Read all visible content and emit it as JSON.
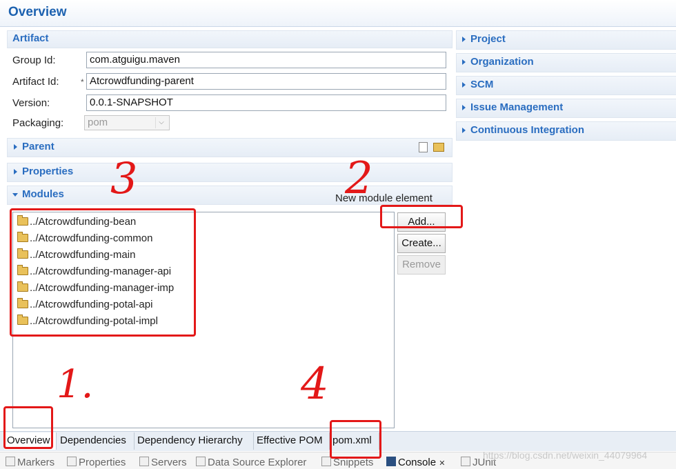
{
  "editor": {
    "title": "Overview"
  },
  "artifact": {
    "title": "Artifact",
    "group_id_label": "Group Id:",
    "group_id_value": "com.atguigu.maven",
    "artifact_id_label": "Artifact Id:",
    "artifact_id_required": "*",
    "artifact_id_value": "Atcrowdfunding-parent",
    "version_label": "Version:",
    "version_value": "0.0.1-SNAPSHOT",
    "packaging_label": "Packaging:",
    "packaging_value": "pom"
  },
  "sections": {
    "parent": "Parent",
    "properties": "Properties",
    "modules": "Modules"
  },
  "right_sections": [
    "Project",
    "Organization",
    "SCM",
    "Issue Management",
    "Continuous Integration"
  ],
  "modules": {
    "hint": "New module element",
    "items": [
      "../Atcrowdfunding-bean",
      "../Atcrowdfunding-common",
      "../Atcrowdfunding-main",
      "../Atcrowdfunding-manager-api",
      "../Atcrowdfunding-manager-imp",
      "../Atcrowdfunding-potal-api",
      "../Atcrowdfunding-potal-impl"
    ],
    "add_label": "Add...",
    "create_label": "Create...",
    "remove_label": "Remove"
  },
  "editor_tabs": [
    "Overview",
    "Dependencies",
    "Dependency Hierarchy",
    "Effective POM",
    "pom.xml"
  ],
  "view_tabs": {
    "markers": "Markers",
    "properties": "Properties",
    "servers": "Servers",
    "data_source": "Data Source Explorer",
    "snippets": "Snippets",
    "console": "Console",
    "console_close": "✕",
    "junit": "JUnit"
  },
  "watermark": "https://blog.csdn.net/weixin_44079964",
  "annotations": {
    "one": "1.",
    "two": "2",
    "three": "3",
    "four": "4"
  },
  "colors": {
    "accent": "#2a6dc0",
    "annotation_red": "#e31818"
  }
}
